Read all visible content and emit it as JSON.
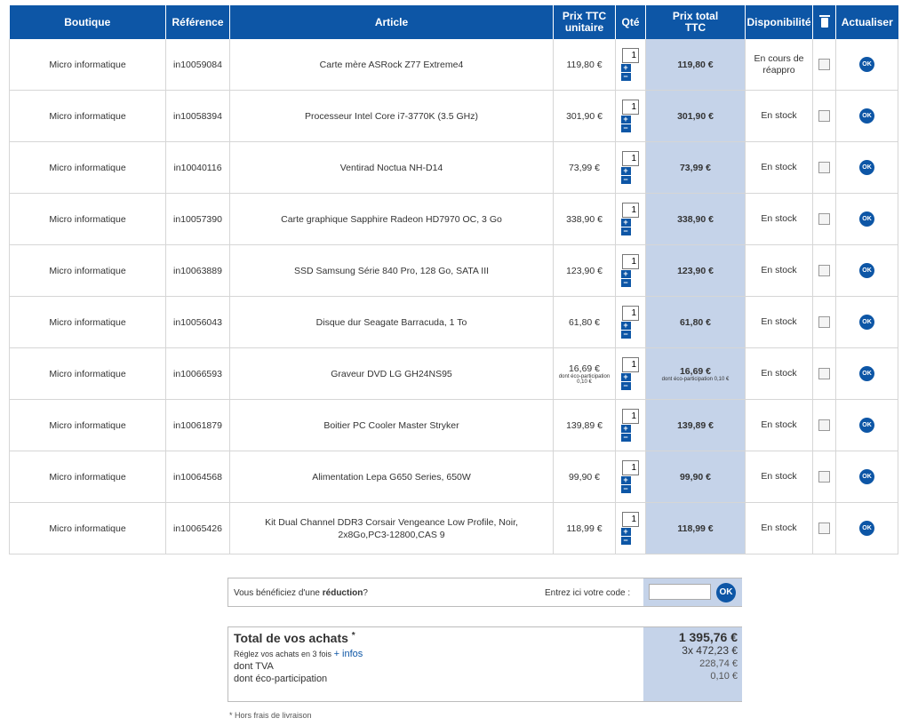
{
  "table": {
    "headers": {
      "boutique": "Boutique",
      "reference": "Référence",
      "article": "Article",
      "prix_unitaire": "Prix TTC unitaire",
      "qte": "Qté",
      "prix_total": "Prix total TTC",
      "disponibilite": "Disponibilité",
      "actualiser": "Actualiser"
    },
    "rows": [
      {
        "boutique": "Micro informatique",
        "ref": "in10059084",
        "article": "Carte mère ASRock Z77 Extreme4",
        "unit": "119,80 €",
        "qty": "1",
        "total": "119,80 €",
        "dispo": "En cours de réappro",
        "eco": ""
      },
      {
        "boutique": "Micro informatique",
        "ref": "in10058394",
        "article": "Processeur Intel Core i7-3770K (3.5 GHz)",
        "unit": "301,90 €",
        "qty": "1",
        "total": "301,90 €",
        "dispo": "En stock",
        "eco": ""
      },
      {
        "boutique": "Micro informatique",
        "ref": "in10040116",
        "article": "Ventirad Noctua NH-D14",
        "unit": "73,99 €",
        "qty": "1",
        "total": "73,99 €",
        "dispo": "En stock",
        "eco": ""
      },
      {
        "boutique": "Micro informatique",
        "ref": "in10057390",
        "article": "Carte graphique Sapphire Radeon HD7970 OC, 3 Go",
        "unit": "338,90 €",
        "qty": "1",
        "total": "338,90 €",
        "dispo": "En stock",
        "eco": ""
      },
      {
        "boutique": "Micro informatique",
        "ref": "in10063889",
        "article": "SSD Samsung Série 840 Pro, 128 Go, SATA III",
        "unit": "123,90 €",
        "qty": "1",
        "total": "123,90 €",
        "dispo": "En stock",
        "eco": ""
      },
      {
        "boutique": "Micro informatique",
        "ref": "in10056043",
        "article": "Disque dur Seagate Barracuda, 1 To",
        "unit": "61,80 €",
        "qty": "1",
        "total": "61,80 €",
        "dispo": "En stock",
        "eco": ""
      },
      {
        "boutique": "Micro informatique",
        "ref": "in10066593",
        "article": "Graveur DVD LG GH24NS95",
        "unit": "16,69 €",
        "qty": "1",
        "total": "16,69 €",
        "dispo": "En stock",
        "eco": "dont éco-participation 0,10 €"
      },
      {
        "boutique": "Micro informatique",
        "ref": "in10061879",
        "article": "Boitier PC Cooler Master Stryker",
        "unit": "139,89 €",
        "qty": "1",
        "total": "139,89 €",
        "dispo": "En stock",
        "eco": ""
      },
      {
        "boutique": "Micro informatique",
        "ref": "in10064568",
        "article": "Alimentation Lepa G650 Series, 650W",
        "unit": "99,90 €",
        "qty": "1",
        "total": "99,90 €",
        "dispo": "En stock",
        "eco": ""
      },
      {
        "boutique": "Micro informatique",
        "ref": "in10065426",
        "article": "Kit Dual Channel DDR3 Corsair Vengeance Low Profile, Noir, 2x8Go,PC3-12800,CAS 9",
        "unit": "118,99 €",
        "qty": "1",
        "total": "118,99 €",
        "dispo": "En stock",
        "eco": ""
      }
    ],
    "stepper_plus": "+",
    "stepper_minus": "−",
    "ok_label": "OK"
  },
  "promo": {
    "text_prefix": "Vous bénéficiez d'une ",
    "text_bold": "réduction",
    "text_suffix": "?",
    "code_label": "Entrez ici votre code :",
    "code_value": "",
    "ok_label": "OK"
  },
  "summary": {
    "title": "Total de vos achats",
    "asterisk": "*",
    "installments_text": "Réglez vos achats en 3 fois",
    "infos_link": "+ infos",
    "tva_label": "dont TVA",
    "eco_label": "dont éco-participation",
    "total_value": "1 395,76 €",
    "installments_value": "3x  472,23 €",
    "tva_value": "228,74 €",
    "eco_value": "0,10 €"
  },
  "footnote": "* Hors frais de livraison",
  "colors": {
    "header_blue": "#0d56a6",
    "total_column_bg": "#c5d3e9"
  },
  "icons": {
    "delete_header": "trash-icon",
    "update": "ok-icon"
  }
}
